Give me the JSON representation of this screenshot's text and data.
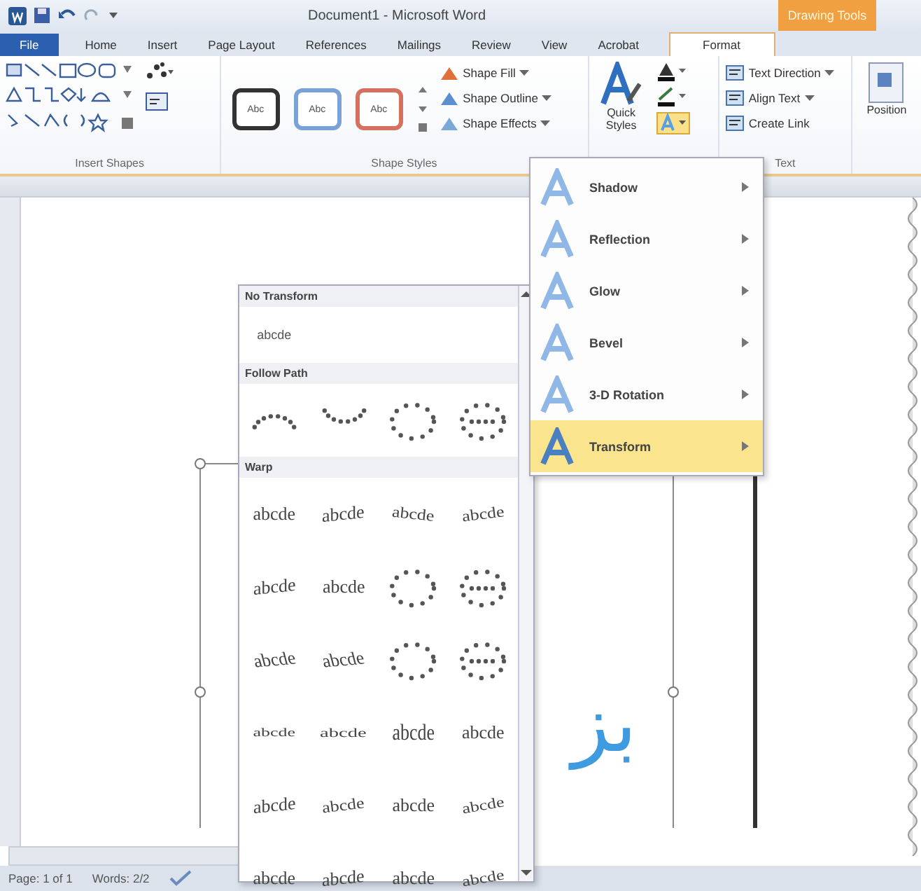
{
  "title_bar": {
    "title": "Document1 - Microsoft Word",
    "contextual_tab": "Drawing Tools"
  },
  "tabs": [
    {
      "label": "File",
      "kind": "file",
      "selected": false
    },
    {
      "label": "Home",
      "kind": "tab",
      "selected": false
    },
    {
      "label": "Insert",
      "kind": "tab",
      "selected": false
    },
    {
      "label": "Page Layout",
      "kind": "tab",
      "selected": false
    },
    {
      "label": "References",
      "kind": "tab",
      "selected": false
    },
    {
      "label": "Mailings",
      "kind": "tab",
      "selected": false
    },
    {
      "label": "Review",
      "kind": "tab",
      "selected": false
    },
    {
      "label": "View",
      "kind": "tab",
      "selected": false
    },
    {
      "label": "Acrobat",
      "kind": "tab",
      "selected": false
    },
    {
      "label": "Format",
      "kind": "contextual",
      "selected": true
    }
  ],
  "ribbon": {
    "insert_shapes_label": "Insert Shapes",
    "shape_styles": [
      {
        "label": "Abc",
        "color": "#333333"
      },
      {
        "label": "Abc",
        "color": "#7aa2d6"
      },
      {
        "label": "Abc",
        "color": "#d6705f"
      }
    ],
    "shape_styles_label": "Shape Styles",
    "shape_commands": [
      {
        "label": "Shape Fill",
        "dropdown": true
      },
      {
        "label": "Shape Outline",
        "dropdown": true
      },
      {
        "label": "Shape Effects",
        "dropdown": true
      }
    ],
    "quick_styles": "Quick Styles",
    "text_effects_open": true,
    "text_commands": [
      {
        "label": "Text Direction",
        "dropdown": true
      },
      {
        "label": "Align Text",
        "dropdown": true
      },
      {
        "label": "Create Link",
        "dropdown": false
      }
    ],
    "text_label": "Text",
    "position": "Position"
  },
  "document": {
    "text": "بز"
  },
  "text_effects_menu": [
    {
      "label": "Shadow",
      "selected": false
    },
    {
      "label": "Reflection",
      "selected": false
    },
    {
      "label": "Glow",
      "selected": false
    },
    {
      "label": "Bevel",
      "selected": false
    },
    {
      "label": "3-D Rotation",
      "selected": false
    },
    {
      "label": "Transform",
      "selected": true
    }
  ],
  "transform_gallery": {
    "sections": [
      {
        "heading": "No Transform",
        "items": [
          {
            "kind": "plain",
            "text": "abcde"
          }
        ]
      },
      {
        "heading": "Follow Path",
        "items": [
          {
            "kind": "arch-up"
          },
          {
            "kind": "arch-down"
          },
          {
            "kind": "circle"
          },
          {
            "kind": "button"
          }
        ]
      },
      {
        "heading": "Warp",
        "items": [
          {
            "kind": "plain",
            "text": "abcde"
          },
          {
            "kind": "wave",
            "text": "abcde"
          },
          {
            "kind": "curve-down",
            "text": "abcde"
          },
          {
            "kind": "curve-up",
            "text": "abcde"
          },
          {
            "kind": "wave",
            "text": "abcde"
          },
          {
            "kind": "plain",
            "text": "abcde"
          },
          {
            "kind": "circle"
          },
          {
            "kind": "button"
          },
          {
            "kind": "chevron",
            "text": "abcde"
          },
          {
            "kind": "chevron",
            "text": "abcde"
          },
          {
            "kind": "circle"
          },
          {
            "kind": "button"
          },
          {
            "kind": "squeeze",
            "text": "abcde"
          },
          {
            "kind": "fade",
            "text": "abcde"
          },
          {
            "kind": "inflate",
            "text": "abcde"
          },
          {
            "kind": "plain",
            "text": "abcde"
          },
          {
            "kind": "wave",
            "text": "abcde"
          },
          {
            "kind": "curve-up",
            "text": "abcde"
          },
          {
            "kind": "plain",
            "text": "abcde"
          },
          {
            "kind": "slant",
            "text": "abcde"
          },
          {
            "kind": "plain",
            "text": "abcde"
          },
          {
            "kind": "wave",
            "text": "abcde"
          },
          {
            "kind": "plain",
            "text": "abcde"
          },
          {
            "kind": "slant",
            "text": "abcde"
          }
        ]
      }
    ]
  },
  "status_bar": {
    "page": "Page: 1 of 1",
    "words": "Words: 2/2"
  }
}
